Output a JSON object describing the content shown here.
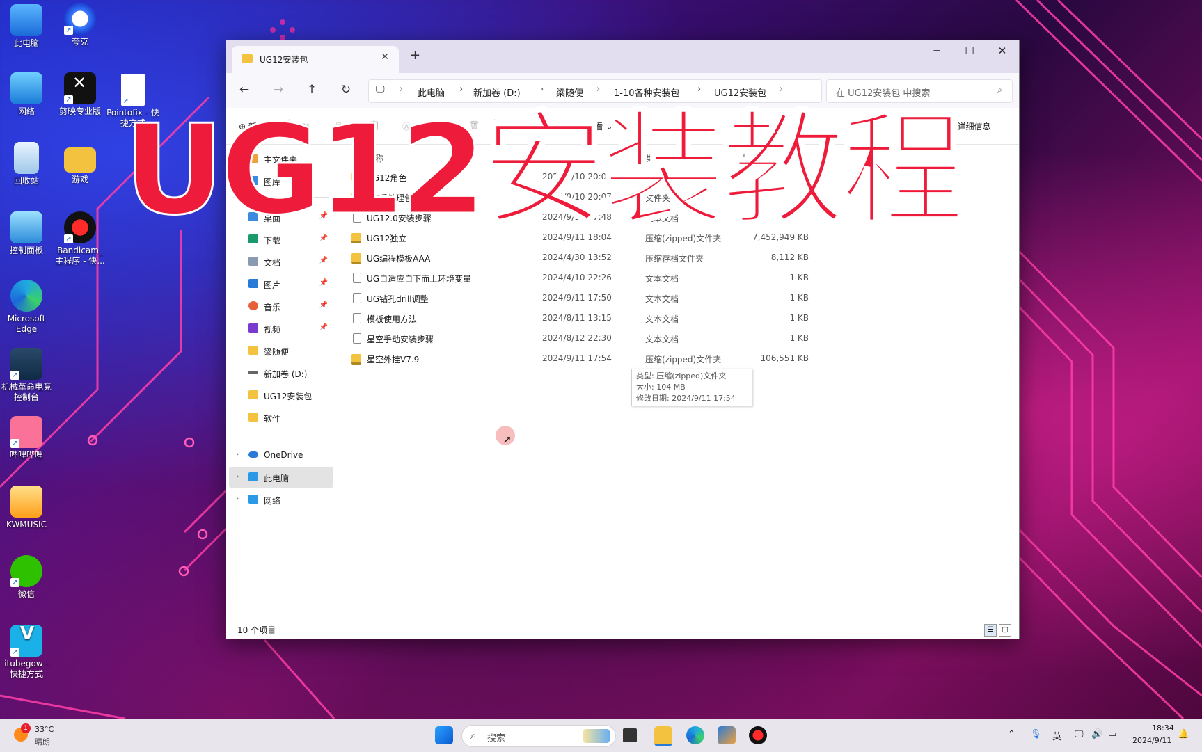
{
  "desktop": {
    "icons": [
      {
        "label": "此电脑"
      },
      {
        "label": "夸克"
      },
      {
        "label": "网络"
      },
      {
        "label": "剪映专业版"
      },
      {
        "label": "Pointofix - 快捷方式"
      },
      {
        "label": "回收站"
      },
      {
        "label": "游戏"
      },
      {
        "label": "控制面板"
      },
      {
        "label": "Bandicam_主程序 - 快..."
      },
      {
        "label": "Microsoft Edge"
      },
      {
        "label": "机械革命电竞控制台"
      },
      {
        "label": "哔哩哔哩"
      },
      {
        "label": "KWMUSIC"
      },
      {
        "label": "微信"
      },
      {
        "label": "itubegow - 快捷方式"
      }
    ]
  },
  "overlay": {
    "title": "UG12安装教程"
  },
  "window": {
    "tab_title": "UG12安装包",
    "breadcrumbs": [
      "此电脑",
      "新加卷 (D:)",
      "梁随便",
      "1-10各种安装包",
      "UG12安装包"
    ],
    "search_placeholder": "在 UG12安装包 中搜索",
    "commands": {
      "new": "新建",
      "sort": "排序",
      "view": "查看",
      "more": "...",
      "details": "详细信息"
    },
    "sidebar": {
      "items": [
        {
          "label": "主文件夹",
          "pinned": false
        },
        {
          "label": "图库",
          "pinned": false
        },
        {
          "label": "桌面",
          "pinned": true
        },
        {
          "label": "下载",
          "pinned": true
        },
        {
          "label": "文档",
          "pinned": true
        },
        {
          "label": "图片",
          "pinned": true
        },
        {
          "label": "音乐",
          "pinned": true
        },
        {
          "label": "视频",
          "pinned": true
        },
        {
          "label": "梁随便",
          "pinned": false
        },
        {
          "label": "新加卷 (D:)",
          "pinned": false
        },
        {
          "label": "UG12安装包",
          "pinned": false
        },
        {
          "label": "软件",
          "pinned": false
        },
        {
          "label": "OneDrive",
          "pinned": false
        },
        {
          "label": "此电脑",
          "pinned": false,
          "selected": true
        },
        {
          "label": "网络",
          "pinned": false
        }
      ]
    },
    "columns": {
      "name": "名称",
      "date": "修改日期",
      "type": "类型",
      "size": "大小"
    },
    "files": [
      {
        "name": "UG12角色",
        "date": "2024/9/10 20:07",
        "type": "文件夹",
        "size": "",
        "icon": "folder"
      },
      {
        "name": "UG后处理包",
        "date": "2024/9/10 20:07",
        "type": "文件夹",
        "size": "",
        "icon": "folder"
      },
      {
        "name": "UG12.0安装步骤",
        "date": "2024/9/11 17:48",
        "type": "文本文档",
        "size": "",
        "icon": "txt"
      },
      {
        "name": "UG12独立",
        "date": "2024/9/11 18:04",
        "type": "压缩(zipped)文件夹",
        "size": "7,452,949 KB",
        "icon": "zip"
      },
      {
        "name": "UG编程模板AAA",
        "date": "2024/4/30 13:52",
        "type": "压缩存档文件夹",
        "size": "8,112 KB",
        "icon": "zip"
      },
      {
        "name": "UG自适应自下而上环境变量",
        "date": "2024/4/10 22:26",
        "type": "文本文档",
        "size": "1 KB",
        "icon": "txt"
      },
      {
        "name": "UG钻孔drill调整",
        "date": "2024/9/11 17:50",
        "type": "文本文档",
        "size": "1 KB",
        "icon": "txt"
      },
      {
        "name": "模板使用方法",
        "date": "2024/8/11 13:15",
        "type": "文本文档",
        "size": "1 KB",
        "icon": "txt"
      },
      {
        "name": "星空手动安装步骤",
        "date": "2024/8/12 22:30",
        "type": "文本文档",
        "size": "1 KB",
        "icon": "txt"
      },
      {
        "name": "星空外挂V7.9",
        "date": "2024/9/11 17:54",
        "type": "压缩(zipped)文件夹",
        "size": "106,551 KB",
        "icon": "zip"
      }
    ],
    "tooltip": [
      "类型: 压缩(zipped)文件夹",
      "大小: 104 MB",
      "修改日期: 2024/9/11 17:54"
    ],
    "status": "10 个项目"
  },
  "taskbar": {
    "weather": {
      "temp": "33°C",
      "desc": "晴朗",
      "badge": "1"
    },
    "search_placeholder": "搜索",
    "tray": {
      "lang": "英",
      "time": "18:34",
      "date": "2024/9/11"
    }
  }
}
